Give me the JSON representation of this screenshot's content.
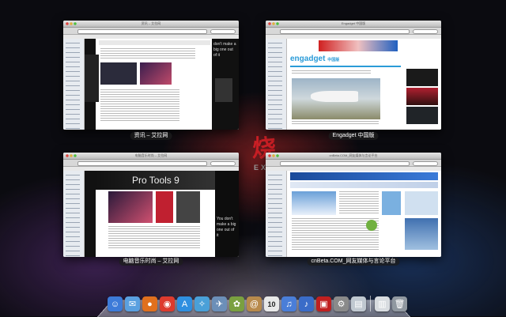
{
  "background_logo": {
    "main": "烧",
    "sub": "EXO"
  },
  "windows": [
    {
      "id": "w1",
      "title": "资讯 – 艾拉网",
      "caption": "资讯 – 艾拉网"
    },
    {
      "id": "w2",
      "title": "Engadget 中国版",
      "caption": "Engadget 中国版",
      "logo": "engadget",
      "logo_suffix": "中国版"
    },
    {
      "id": "w3",
      "title": "电脑音乐时尚 – 艾拉网",
      "caption": "电脑音乐时尚 – 艾拉网",
      "banner": "Pro Tools 9"
    },
    {
      "id": "w4",
      "title": "cnBeta.COM_网友媒体与言论平台",
      "caption": "cnBeta.COM_网友媒体与言论平台"
    }
  ],
  "dock": {
    "items": [
      {
        "name": "finder-icon",
        "glyph": "☺",
        "color": "#3d7bd8"
      },
      {
        "name": "ichat-icon",
        "glyph": "✉",
        "color": "#5aa0e0"
      },
      {
        "name": "firefox-icon",
        "glyph": "●",
        "color": "#e0701e"
      },
      {
        "name": "chrome-icon",
        "glyph": "◉",
        "color": "#dd3b2e"
      },
      {
        "name": "app-store-icon",
        "glyph": "A",
        "color": "#2f8fe0"
      },
      {
        "name": "safari-icon",
        "glyph": "✧",
        "color": "#4aa0d8"
      },
      {
        "name": "mail-icon",
        "glyph": "✈",
        "color": "#6c8fb8"
      },
      {
        "name": "iphoto-icon",
        "glyph": "✿",
        "color": "#7aa040"
      },
      {
        "name": "address-book-icon",
        "glyph": "@",
        "color": "#b88a4c"
      },
      {
        "name": "calendar-icon",
        "glyph": "10",
        "color": "#e8e8e8"
      },
      {
        "name": "itunes-icon",
        "glyph": "♫",
        "color": "#4a7ed8"
      },
      {
        "name": "itunes-alt-icon",
        "glyph": "♪",
        "color": "#3a6cc8"
      },
      {
        "name": "photobooth-icon",
        "glyph": "▣",
        "color": "#c02020"
      },
      {
        "name": "system-preferences-icon",
        "glyph": "⚙",
        "color": "#8a8a8a"
      },
      {
        "name": "preview-icon",
        "glyph": "▤",
        "color": "#c0c8d0"
      },
      {
        "name": "documents-icon",
        "glyph": "▥",
        "color": "#d8dce0"
      },
      {
        "name": "trash-icon",
        "glyph": "🗑",
        "color": "#9098a0"
      }
    ]
  },
  "colors": {
    "accent_red": "#c91f25",
    "caption_bg": "#1e1e1e"
  }
}
